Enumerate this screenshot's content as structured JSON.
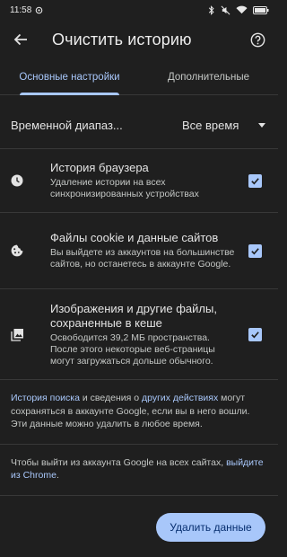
{
  "status_bar": {
    "time": "11:58"
  },
  "app_bar": {
    "title": "Очистить историю"
  },
  "tabs": [
    {
      "label": "Основные настройки",
      "active": true
    },
    {
      "label": "Дополнительные",
      "active": false
    }
  ],
  "time_range": {
    "label": "Временной диапаз...",
    "value": "Все время"
  },
  "items": [
    {
      "title": "История браузера",
      "subtitle": "Удаление истории на всех синхронизированных устройствах",
      "checked": true
    },
    {
      "title": "Файлы cookie и данные сайтов",
      "subtitle": "Вы выйдете из аккаунтов на большинстве сайтов, но останетесь в аккаунте Google.",
      "checked": true
    },
    {
      "title": "Изображения и другие файлы, сохраненные в кеше",
      "subtitle": "Освободится 39,2 МБ пространства. После этого некоторые веб-страницы могут загружаться дольше обычного.",
      "checked": true
    }
  ],
  "info1": {
    "link1": "История поиска",
    "text1": " и сведения о ",
    "link2": "других действиях",
    "text2": " могут сохраняться в аккаунте Google, если вы в него вошли. Эти данные можно удалить в любое время."
  },
  "info2": {
    "text1": "Чтобы выйти из аккаунта Google на всех сайтах, ",
    "link": "выйдите из Chrome",
    "text2": "."
  },
  "delete_button": "Удалить данные",
  "colors": {
    "background": "#1f1f1f",
    "accent": "#a8c7fa",
    "button_text": "#062e6f"
  }
}
